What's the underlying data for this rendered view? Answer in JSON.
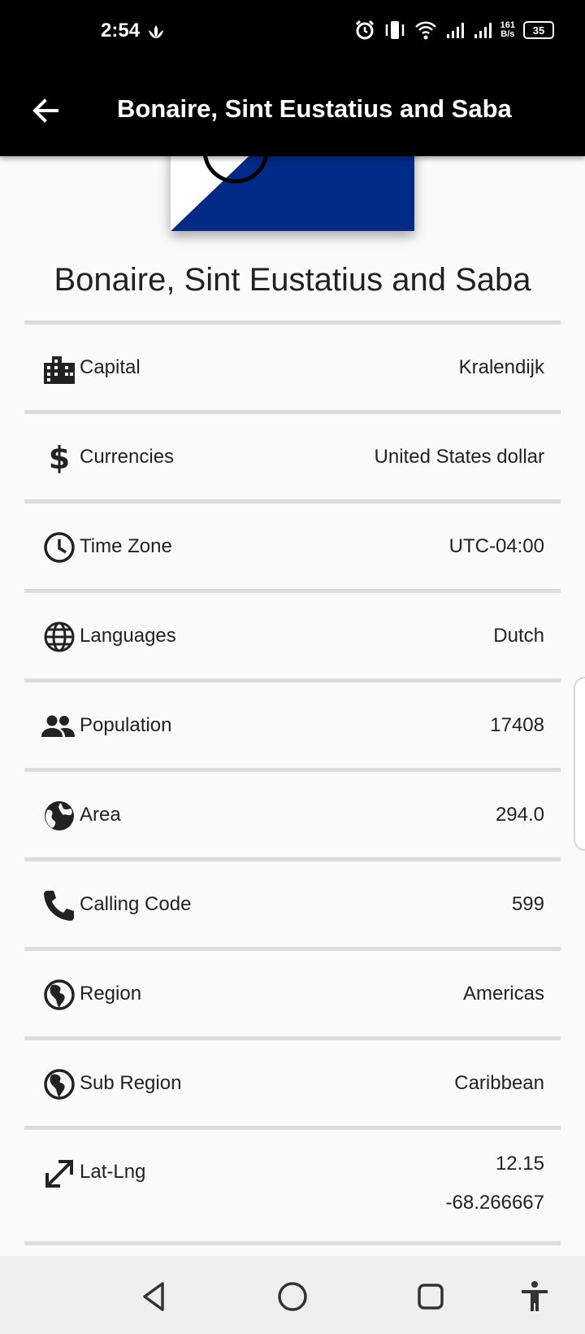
{
  "status_bar": {
    "time": "2:54",
    "speed_top": "161",
    "speed_bottom": "B/s",
    "battery": "35"
  },
  "app_bar": {
    "title": "Bonaire, Sint Eustatius and Saba",
    "back_icon": "arrow-back-icon"
  },
  "flag": {
    "colors": {
      "white": "#ffffff",
      "blue": "#012a87",
      "yellow": "#f9d90f",
      "red": "#dc171d"
    }
  },
  "country": {
    "name": "Bonaire, Sint Eustatius and Saba"
  },
  "details": [
    {
      "icon": "city-icon",
      "label": "Capital",
      "value": "Kralendijk"
    },
    {
      "icon": "dollar-icon",
      "label": "Currencies",
      "value": "United States dollar"
    },
    {
      "icon": "clock-icon",
      "label": "Time Zone",
      "value": "UTC-04:00"
    },
    {
      "icon": "globe-icon",
      "label": "Languages",
      "value": "Dutch"
    },
    {
      "icon": "people-icon",
      "label": "Population",
      "value": "17408"
    },
    {
      "icon": "earth-icon",
      "label": "Area",
      "value": "294.0"
    },
    {
      "icon": "phone-icon",
      "label": "Calling Code",
      "value": "599"
    },
    {
      "icon": "americas-icon",
      "label": "Region",
      "value": "Americas"
    },
    {
      "icon": "americas-icon",
      "label": "Sub Region",
      "value": "Caribbean"
    },
    {
      "icon": "expand-arrows-icon",
      "label": "Lat-Lng",
      "value": "12.15",
      "value2": "-68.266667"
    }
  ],
  "nav_bar": {
    "back": "nav-back-icon",
    "home": "nav-home-icon",
    "recents": "nav-recents-icon",
    "accessibility": "accessibility-icon"
  }
}
